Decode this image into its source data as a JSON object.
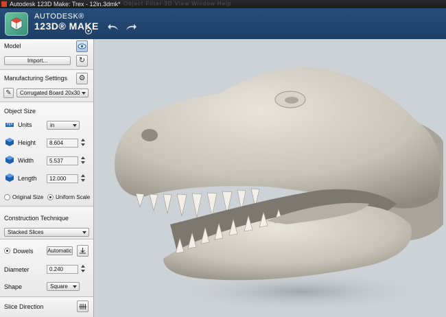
{
  "titlebar": {
    "title": "Autodesk 123D Make: Trex - 12in.3dmk*",
    "menu_ghost": "Object  Filter  3D  View  Window  Help"
  },
  "brand": {
    "line1": "AUTODESK®",
    "line2": "123D® MAKE"
  },
  "icons": {
    "logo": "123d-make-logo-icon",
    "undo": "undo-arrow-icon",
    "redo": "redo-arrow-icon",
    "eye": "eye-icon",
    "refresh": "refresh-icon",
    "gear": "gear-icon",
    "pencil": "pencil-icon",
    "units": "ruler-icon",
    "height": "height-cube-icon",
    "width": "width-cube-icon",
    "length": "length-cube-icon",
    "align": "align-icon",
    "slice_dir": "slice-direction-icon"
  },
  "model": {
    "title": "Model",
    "import_label": "Import..."
  },
  "manufacturing": {
    "title": "Manufacturing Settings",
    "material": "Corrugated Board 20x30"
  },
  "object_size": {
    "title": "Object Size",
    "units_label": "Units",
    "units_value": "in",
    "height_label": "Height",
    "height_value": "8.604",
    "width_label": "Width",
    "width_value": "5.537",
    "length_label": "Length",
    "length_value": "12.000",
    "original_size": "Original Size",
    "uniform_scale": "Uniform Scale"
  },
  "construction": {
    "title": "Construction Technique",
    "technique": "Stacked Slices"
  },
  "dowels": {
    "label": "Dowels",
    "mode": "Automatic",
    "diameter_label": "Diameter",
    "diameter_value": "0.240",
    "shape_label": "Shape",
    "shape_value": "Square"
  },
  "slice": {
    "title": "Slice Direction"
  },
  "colors": {
    "header": "#214670",
    "panel": "#ececec",
    "viewport": "#cdd2d6",
    "model": "#c8c4bb"
  }
}
